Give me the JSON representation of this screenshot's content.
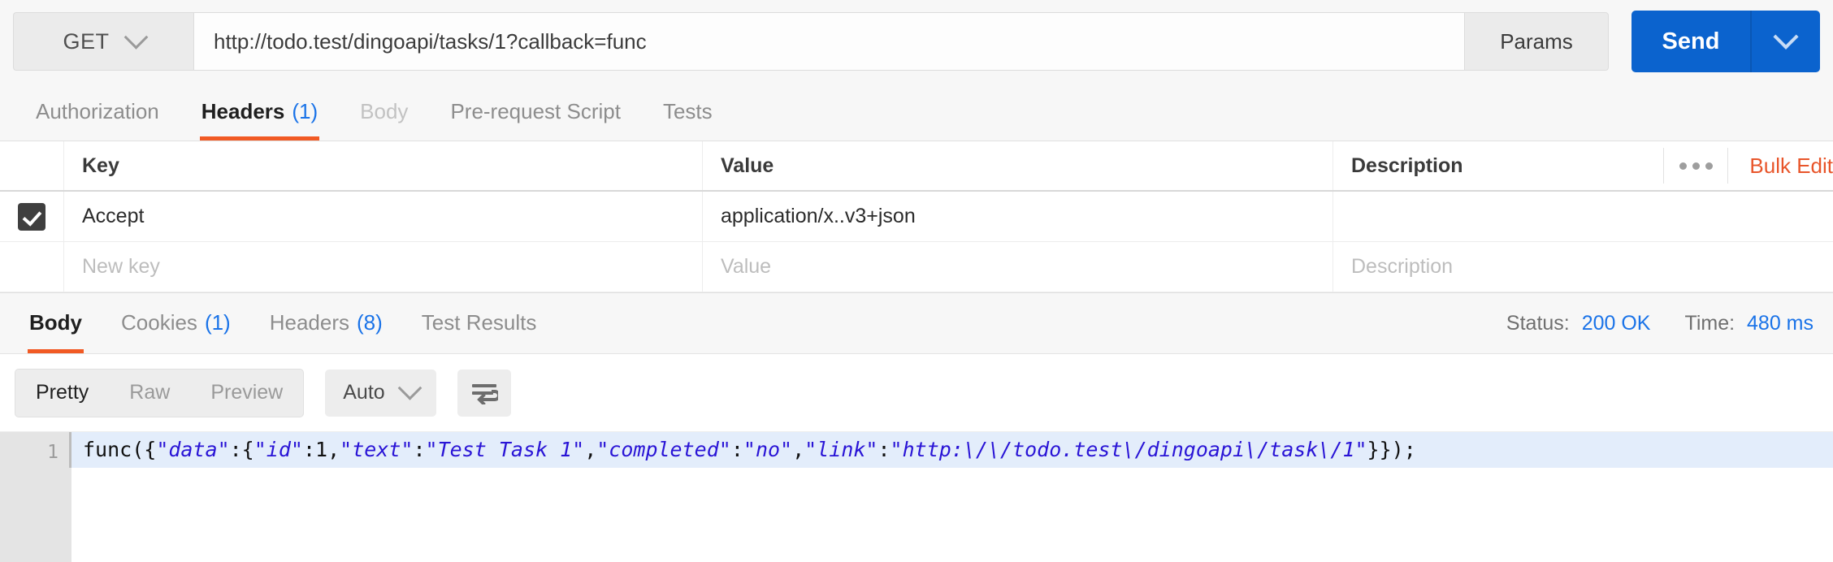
{
  "request": {
    "method": "GET",
    "url": "http://todo.test/dingoapi/tasks/1?callback=func",
    "params_label": "Params",
    "send_label": "Send",
    "send_caret_icon": "chevron-down-icon",
    "method_caret_icon": "chevron-down-icon",
    "tabs": [
      {
        "label": "Authorization",
        "count": "",
        "state": "inactive"
      },
      {
        "label": "Headers",
        "count": "(1)",
        "state": "active"
      },
      {
        "label": "Body",
        "count": "",
        "state": "disabled"
      },
      {
        "label": "Pre-request Script",
        "count": "",
        "state": "inactive"
      },
      {
        "label": "Tests",
        "count": "",
        "state": "inactive"
      }
    ]
  },
  "headers_table": {
    "columns": [
      "Key",
      "Value",
      "Description"
    ],
    "actions": {
      "more_icon": "ellipsis-icon",
      "bulk_edit_label": "Bulk Edit"
    },
    "rows": [
      {
        "enabled": true,
        "key": "Accept",
        "value": "application/x..v3+json",
        "description": ""
      }
    ],
    "new_row": {
      "key_placeholder": "New key",
      "value_placeholder": "Value",
      "description_placeholder": "Description"
    }
  },
  "response": {
    "tabs": [
      {
        "label": "Body",
        "count": "",
        "state": "active"
      },
      {
        "label": "Cookies",
        "count": "(1)",
        "state": "inactive"
      },
      {
        "label": "Headers",
        "count": "(8)",
        "state": "inactive"
      },
      {
        "label": "Test Results",
        "count": "",
        "state": "inactive"
      }
    ],
    "status_label": "Status:",
    "status_value": "200 OK",
    "time_label": "Time:",
    "time_value": "480 ms",
    "toolbar": {
      "view_modes": [
        "Pretty",
        "Raw",
        "Preview"
      ],
      "active_view_mode": "Pretty",
      "format_label": "Auto",
      "format_caret_icon": "chevron-down-icon",
      "wrap_icon": "word-wrap-icon"
    },
    "body": {
      "line_number": "1",
      "raw": "func({\"data\":{\"id\":1,\"text\":\"Test Task 1\",\"completed\":\"no\",\"link\":\"http:\\/\\/todo.test\\/dingoapi\\/task\\/1\"}});",
      "tokens": [
        {
          "t": "p",
          "v": "func({"
        },
        {
          "t": "s",
          "v": "\"data\""
        },
        {
          "t": "p",
          "v": ":{"
        },
        {
          "t": "s",
          "v": "\"id\""
        },
        {
          "t": "p",
          "v": ":"
        },
        {
          "t": "n",
          "v": "1"
        },
        {
          "t": "p",
          "v": ","
        },
        {
          "t": "s",
          "v": "\"text\""
        },
        {
          "t": "p",
          "v": ":"
        },
        {
          "t": "s",
          "v": "\"Test Task 1\""
        },
        {
          "t": "p",
          "v": ","
        },
        {
          "t": "s",
          "v": "\"completed\""
        },
        {
          "t": "p",
          "v": ":"
        },
        {
          "t": "s",
          "v": "\"no\""
        },
        {
          "t": "p",
          "v": ","
        },
        {
          "t": "s",
          "v": "\"link\""
        },
        {
          "t": "p",
          "v": ":"
        },
        {
          "t": "s",
          "v": "\"http:\\/\\/todo.test\\/dingoapi\\/task\\/1\""
        },
        {
          "t": "p",
          "v": "}});"
        }
      ]
    }
  },
  "colors": {
    "accent_orange": "#f15a24",
    "link_blue": "#1a73e8",
    "send_blue": "#0b63ce",
    "bulk_edit_orange": "#e8552a",
    "code_string": "#2914d6",
    "highlight_line": "#e3edfb"
  }
}
